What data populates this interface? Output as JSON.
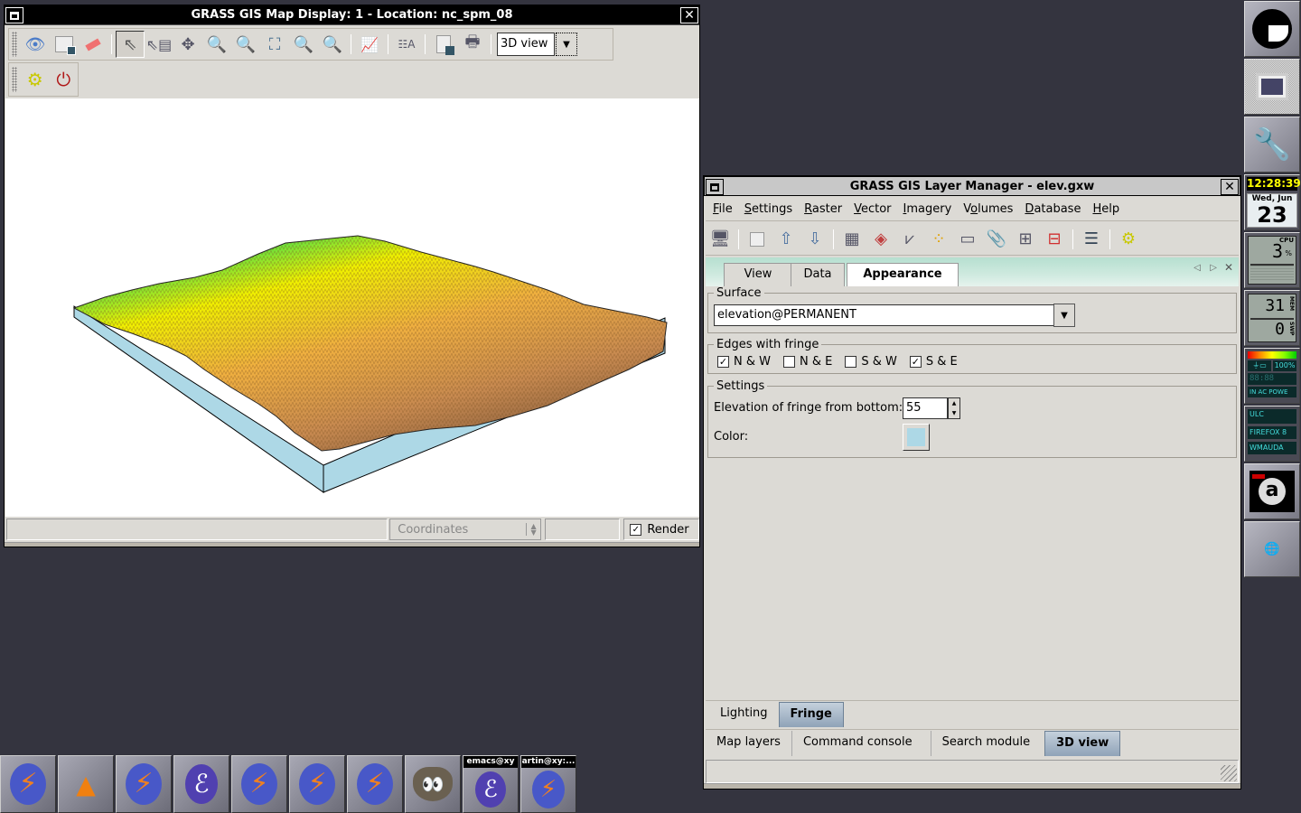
{
  "map_display": {
    "title": "GRASS GIS Map Display: 1  - Location: nc_spm_08",
    "toolbar": {
      "tools": [
        {
          "name": "display-map-icon",
          "label": "Display map"
        },
        {
          "name": "render-map-icon",
          "label": "Render map"
        },
        {
          "name": "erase-icon",
          "label": "Erase display"
        },
        {
          "name": "pointer-icon",
          "label": "Pointer",
          "pressed": true
        },
        {
          "name": "query-icon",
          "label": "Query"
        },
        {
          "name": "pan-icon",
          "label": "Pan"
        },
        {
          "name": "zoom-in-icon",
          "label": "Zoom in"
        },
        {
          "name": "zoom-out-icon",
          "label": "Zoom out"
        },
        {
          "name": "zoom-extent-icon",
          "label": "Zoom to extent"
        },
        {
          "name": "zoom-back-icon",
          "label": "Zoom back"
        },
        {
          "name": "zoom-menu-icon",
          "label": "Zoom menu"
        },
        {
          "name": "analyze-icon",
          "label": "Analyze"
        },
        {
          "name": "overlay-icon",
          "label": "Decorations"
        },
        {
          "name": "save-image-icon",
          "label": "Save display"
        },
        {
          "name": "print-icon",
          "label": "Print"
        }
      ],
      "mode_select": "3D view"
    },
    "nviz_toolbar": {
      "settings_label": "Settings",
      "quit_label": "Quit 3D view"
    },
    "statusbar": {
      "left_text": "",
      "coordinates_label": "Coordinates",
      "value_text": "",
      "render_label": "Render",
      "render_checked": true
    },
    "colors": {
      "fringe": "#add8e6",
      "terrain_low": "#30c8a0",
      "terrain_mid": "#f0f000",
      "terrain_high": "#c88a50"
    }
  },
  "layer_manager": {
    "title": "GRASS GIS Layer Manager - elev.gxw",
    "menu": [
      {
        "label": "File",
        "mnemonic": "F",
        "rest": "ile"
      },
      {
        "label": "Settings",
        "mnemonic": "S",
        "rest": "ettings"
      },
      {
        "label": "Raster",
        "mnemonic": "R",
        "rest": "aster"
      },
      {
        "label": "Vector",
        "mnemonic": "V",
        "rest": "ector"
      },
      {
        "label": "Imagery",
        "mnemonic": "I",
        "rest": "magery"
      },
      {
        "label": "Volumes",
        "pre": "V",
        "mnemonic": "o",
        "rest": "lumes"
      },
      {
        "label": "Database",
        "mnemonic": "D",
        "rest": "atabase"
      },
      {
        "label": "Help",
        "mnemonic": "H",
        "rest": "elp"
      }
    ],
    "toolbar": [
      "new-display-icon",
      "workspace-icon",
      "load-icon",
      "save-icon",
      "add-raster-icon",
      "add-rgb-icon",
      "add-vector-icon",
      "add-theme-icon",
      "add-command-icon",
      "add-group-icon",
      "add-grid-icon",
      "remove-layer-icon",
      "attribute-table-icon",
      "settings-icon"
    ],
    "nviz_tabs": [
      {
        "label": "View",
        "active": false
      },
      {
        "label": "Data",
        "active": false
      },
      {
        "label": "Appearance",
        "active": true
      }
    ],
    "surface": {
      "group_label": "Surface",
      "value": "elevation@PERMANENT"
    },
    "edges": {
      "group_label": "Edges with fringe",
      "items": [
        {
          "label": "N & W",
          "checked": true
        },
        {
          "label": "N & E",
          "checked": false
        },
        {
          "label": "S & W",
          "checked": false
        },
        {
          "label": "S & E",
          "checked": true
        }
      ]
    },
    "settings": {
      "group_label": "Settings",
      "elevation_label": "Elevation of fringe from bottom:",
      "elevation_value": "55",
      "color_label": "Color:",
      "color_value": "#add8e6"
    },
    "appearance_tabs": [
      {
        "label": "Lighting",
        "active": false
      },
      {
        "label": "Fringe",
        "active": true
      }
    ],
    "main_tabs": [
      {
        "label": "Map layers",
        "active": false
      },
      {
        "label": "Command console",
        "active": false
      },
      {
        "label": "Search module",
        "active": false
      },
      {
        "label": "3D view",
        "active": true
      }
    ],
    "status_text": ""
  },
  "dock": {
    "clock": "12:28:39",
    "date_day": "Wed, Jun",
    "date_num": "23",
    "cpu_label": "CPU",
    "cpu_value": "3",
    "mem_label": "MEM",
    "mem_value": "31",
    "swp_label": "SWP",
    "swp_value": "0",
    "battery_percent": "100%",
    "battery_time": "88:88",
    "battery_status": "IN AC POWE",
    "apps_list": [
      "ULC",
      "FIREFOX 8",
      "WMAUDA"
    ]
  },
  "taskbar": {
    "items": [
      {
        "name": "grass-task-1",
        "label": ""
      },
      {
        "name": "vlc-task",
        "label": ""
      },
      {
        "name": "grass-task-2",
        "label": ""
      },
      {
        "name": "emacs-task-1",
        "label": ""
      },
      {
        "name": "grass-task-3",
        "label": ""
      },
      {
        "name": "grass-task-4",
        "label": ""
      },
      {
        "name": "grass-task-5",
        "label": ""
      },
      {
        "name": "gimp-task",
        "label": ""
      },
      {
        "name": "emacs-task-2",
        "label": "emacs@xy"
      },
      {
        "name": "terminal-task",
        "label": "artin@xy:..."
      }
    ]
  }
}
